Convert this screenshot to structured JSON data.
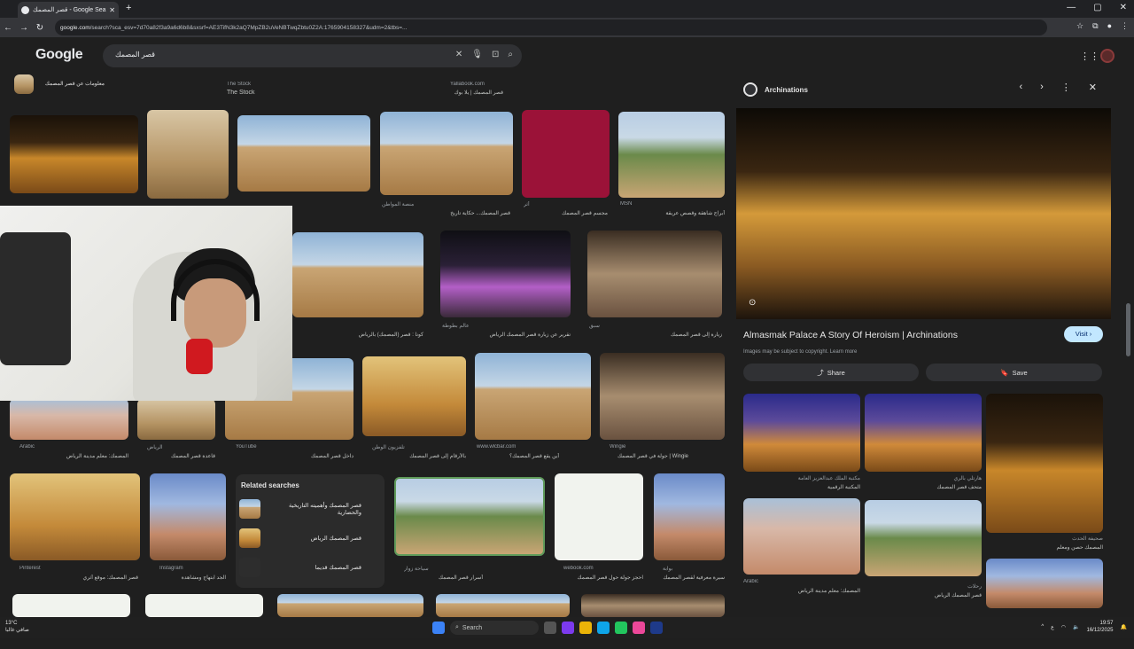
{
  "browser": {
    "tab_title": "قصر المصمك - Google Search",
    "new_tab": "+",
    "url_host": "google.com",
    "url_rest": "/search?sca_esv=7d70a82f3a9a6d6b8&sxsrf=AE3TifN3k2aQ7MpZB2uVeNBTwqZbtu0Z2A:1765904158327&udm=2&tbs=...",
    "window_controls": [
      "—",
      "▢",
      "✕"
    ]
  },
  "google": {
    "logo": "Google",
    "query": "قصر المصمك"
  },
  "grid": {
    "top_captions": [
      {
        "source": "The Stock",
        "title": "The Stock"
      },
      {
        "source": "Yallabook.com",
        "title": "قصر المصمك | يلا بوك"
      },
      {
        "source": "",
        "title": "معلومات عن قصر المصمك"
      }
    ],
    "row1": [
      {
        "source": "",
        "title": ""
      },
      {
        "source": "",
        "title": ""
      },
      {
        "source": "YouTube",
        "title": "جولة في قصر المصمك"
      },
      {
        "source": "منصة المواطن",
        "title": "قصر المصمك... حكاية تاريخ"
      },
      {
        "source": "أثر",
        "title": "مجسم قصر المصمك"
      },
      {
        "source": "MSN",
        "title": "أبراج شاهقة وقصص عريقة"
      }
    ],
    "row2": [
      {
        "source": "",
        "title": "كونا : قصر (المصمك) بالرياض"
      },
      {
        "source": "عالم بطوطة",
        "title": "تقرير عن زيارة قصر المصمك الرياض"
      },
      {
        "source": "سبق",
        "title": "زيارة إلى قصر المصمك"
      }
    ],
    "row3": [
      {
        "source": "Arabic",
        "title": "المصمك: معلم مدينة الرياض"
      },
      {
        "source": "الرياض",
        "title": "قاعدة قصر المصمك"
      },
      {
        "source": "YouTube",
        "title": "داخل قصر المصمك"
      },
      {
        "source": "تلفزيون الوطن",
        "title": "بالأرقام إلى قصر المصمك"
      },
      {
        "source": "www.wlcbar.com",
        "title": "أين يقع قصر المصمك؟"
      },
      {
        "source": "Wingie",
        "title": "Wingie | جولة في قصر المصمك"
      }
    ],
    "row4": [
      {
        "source": "Pinterest",
        "title": "قصر المصمك: موقع أثري"
      },
      {
        "source": "Instagram",
        "title": "الجد ابتهاج ومشاهدة"
      },
      {
        "source": "سياحة زوار",
        "title": "أسرار قصر المصمك"
      },
      {
        "source": "webook.com",
        "title": "احجز جولة حول قصر المصمك"
      },
      {
        "source": "بوابة",
        "title": "سيرة معرفية لقصر المصمك"
      }
    ]
  },
  "related": {
    "heading": "Related searches",
    "items": [
      "قصر المصمك وأهميته التاريخية والحضارية",
      "قصر المصمك الرياض",
      "قصر المصمك قديما"
    ]
  },
  "panel": {
    "site": "Archinations",
    "controls": [
      "‹",
      "›",
      "⋮",
      "✕"
    ],
    "title": "Almasmak Palace A Story Of Heroism | Archinations",
    "visit": "Visit ›",
    "note": "Images may be subject to copyright. Learn more",
    "share": "Share",
    "save": "Save",
    "related": [
      {
        "source": "مكتبة الملك عبدالعزيز العامة",
        "title": "المكتبة الرقمية"
      },
      {
        "source": "هارتلي بالري",
        "title": "متحف قصر المصمك"
      },
      {
        "source": "صحيفة الحدث",
        "title": "المصمك حصن ومعلم"
      },
      {
        "source": "Arabic",
        "title": "المصمك: معلم مدينة الرياض"
      },
      {
        "source": "رحلات",
        "title": "قصر المصمك الرياض"
      },
      {
        "source": "",
        "title": ""
      }
    ]
  },
  "taskbar": {
    "weather_temp": "13°C",
    "weather_desc": "صافي غالبا",
    "search": "Search",
    "lang": "ع",
    "time": "19:57",
    "date": "16/12/2025"
  }
}
